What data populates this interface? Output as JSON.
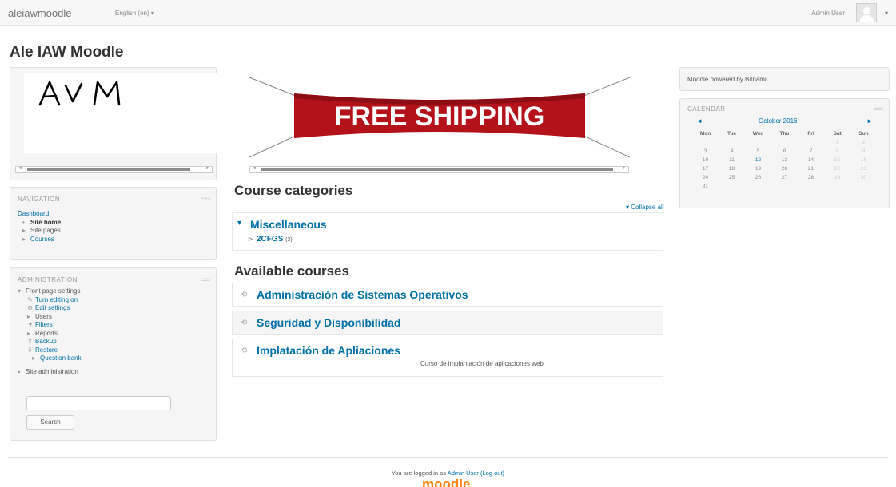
{
  "navbar": {
    "brand": "aleiawmoodle",
    "language": "English (en) ▾",
    "user_name": "Admin User",
    "caret": "▾"
  },
  "site_title": "Ale IAW Moodle",
  "logo_block": {
    "logo_text": "AVM"
  },
  "navigation": {
    "header": "NAVIGATION",
    "items": [
      "Dashboard",
      "Site home",
      "Site pages",
      "Courses"
    ]
  },
  "administration": {
    "header": "ADMINISTRATION",
    "front_page_settings": "Front page settings",
    "items": [
      "Turn editing on",
      "Edit settings",
      "Users",
      "Filters",
      "Reports",
      "Backup",
      "Restore",
      "Question bank"
    ],
    "site_administration": "Site administration",
    "search_button": "Search"
  },
  "banner": {
    "text": "FREE SHIPPING"
  },
  "course_categories": {
    "heading": "Course categories",
    "collapse_all": "Collapse all",
    "category": "Miscellaneous",
    "subcategory": "2CFGS",
    "subcategory_count": "(3)"
  },
  "available_courses": {
    "heading": "Available courses",
    "courses": [
      {
        "name": "Administración de Sistemas Operativos",
        "summary": ""
      },
      {
        "name": "Seguridad y Disponibilidad",
        "summary": ""
      },
      {
        "name": "Implatación de Apliaciones",
        "summary": "Curso de implantación de aplicaciones web"
      }
    ]
  },
  "right_block": {
    "text": "Moodle powered by Bitnami"
  },
  "calendar": {
    "header": "CALENDAR",
    "month": "October 2016",
    "prev": "◄",
    "next": "►",
    "days": [
      "Mon",
      "Tue",
      "Wed",
      "Thu",
      "Fri",
      "Sat",
      "Sun"
    ],
    "weeks": [
      [
        "",
        "",
        "",
        "",
        "",
        "1",
        "2"
      ],
      [
        "3",
        "4",
        "5",
        "6",
        "7",
        "8",
        "9"
      ],
      [
        "10",
        "11",
        "12",
        "13",
        "14",
        "15",
        "16"
      ],
      [
        "17",
        "18",
        "19",
        "20",
        "21",
        "22",
        "23"
      ],
      [
        "24",
        "25",
        "26",
        "27",
        "28",
        "29",
        "30"
      ],
      [
        "31",
        "",
        "",
        "",
        "",
        "",
        ""
      ]
    ],
    "today": "12"
  },
  "footer": {
    "logged_in_prefix": "You are logged in as ",
    "user_link": "Admin User",
    "logout": "(Log out)",
    "logo": "moodle"
  }
}
